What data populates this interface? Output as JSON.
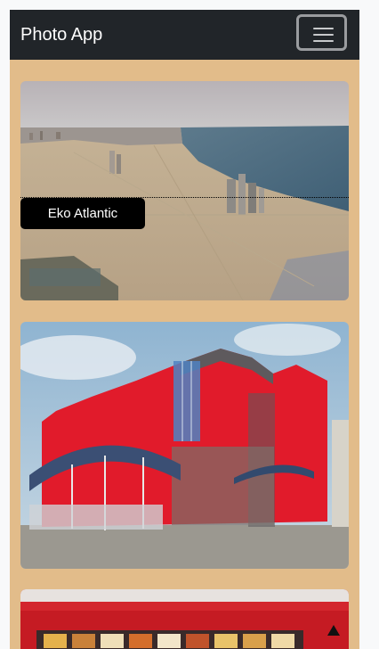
{
  "navbar": {
    "brand": "Photo App",
    "toggle_icon": "hamburger-icon"
  },
  "photos": [
    {
      "caption": "Eko Atlantic",
      "scene": "aerial-coastline-city"
    },
    {
      "caption": "",
      "scene": "red-building"
    },
    {
      "caption": "",
      "scene": "restaurant-interior"
    }
  ],
  "colors": {
    "page_background": "#e2bc8a",
    "navbar": "#212529",
    "caption_background": "#000000"
  }
}
